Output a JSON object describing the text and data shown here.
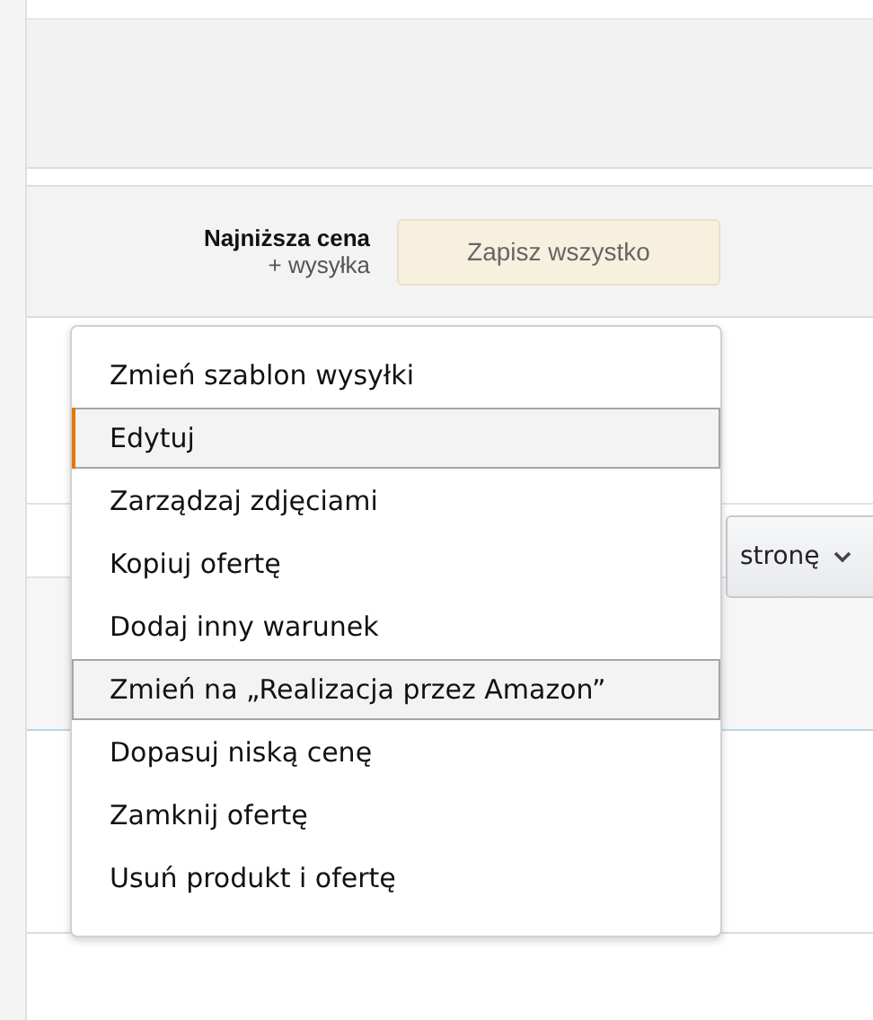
{
  "header": {
    "price_label": "Najniższa cena",
    "shipping_label": "+ wysyłka",
    "save_button": "Zapisz wszystko"
  },
  "toolbar": {
    "page_button": "stronę"
  },
  "menu": {
    "items": [
      {
        "label": "Zmień szablon wysyłki",
        "highlighted": false,
        "focused": false
      },
      {
        "label": "Edytuj",
        "highlighted": true,
        "focused": true
      },
      {
        "label": "Zarządzaj zdjęciami",
        "highlighted": false,
        "focused": false
      },
      {
        "label": "Kopiuj ofertę",
        "highlighted": false,
        "focused": false
      },
      {
        "label": "Dodaj inny warunek",
        "highlighted": false,
        "focused": false
      },
      {
        "label": "Zmień na „Realizacja przez Amazon”",
        "highlighted": true,
        "focused": false
      },
      {
        "label": "Dopasuj niską cenę",
        "highlighted": false,
        "focused": false
      },
      {
        "label": "Zamknij ofertę",
        "highlighted": false,
        "focused": false
      },
      {
        "label": "Usuń produkt i ofertę",
        "highlighted": false,
        "focused": false
      }
    ]
  }
}
